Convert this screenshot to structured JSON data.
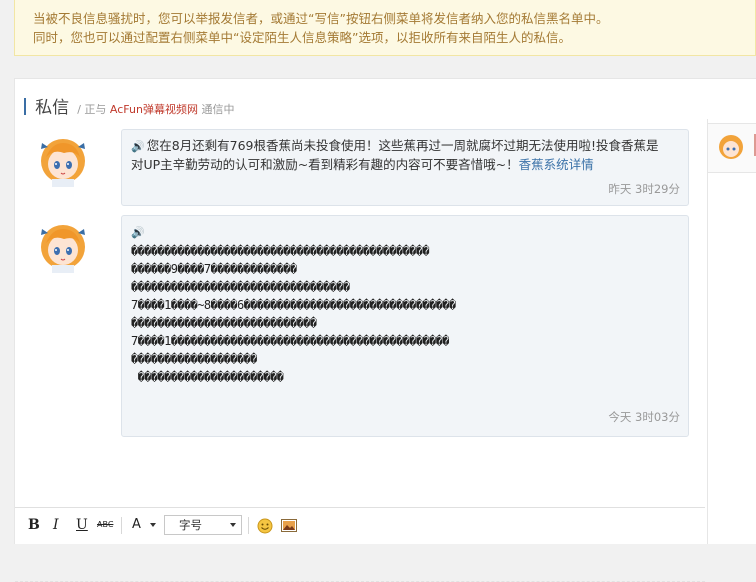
{
  "notice": {
    "line1": "当被不良信息骚扰时，您可以举报发信者，或通过“写信”按钮右侧菜单将发信者纳入您的私信黑名单中。",
    "line2": "同时，您也可以通过配置右侧菜单中“设定陌生人信息策略”选项，以拒收所有来自陌生人的私信。"
  },
  "header": {
    "title": "私信",
    "prefix": "/ 正与",
    "site": "AcFun弹幕视频网",
    "suffix": "通信中"
  },
  "messages": [
    {
      "speaker_icon": "🔊",
      "line1": "您在8月还剩有769根香蕉尚未投食使用！这些蕉再过一周就腐坏过期无法使用啦!投食香蕉是",
      "line2": "对UP主辛勤劳动的认可和激励~看到精彩有趣的内容可不要吝惜哦~！",
      "link": "香蕉系统详情",
      "time": "昨天 3时29分"
    },
    {
      "speaker_icon": "🔊",
      "lines": [
        "���������������������������������������������",
        "������9����7�������������",
        "���������������������������������",
        "7����1����~8����6��������������������������������",
        "����������������������������",
        "7����1������������������������������������������",
        "�������������������",
        "",
        " ����������������������"
      ],
      "time": "今天 3时03分"
    }
  ],
  "toolbar": {
    "bold": "B",
    "italic": "I",
    "underline": "U",
    "strike": "ABC",
    "font_color": "A",
    "font_size_label": "字号"
  }
}
